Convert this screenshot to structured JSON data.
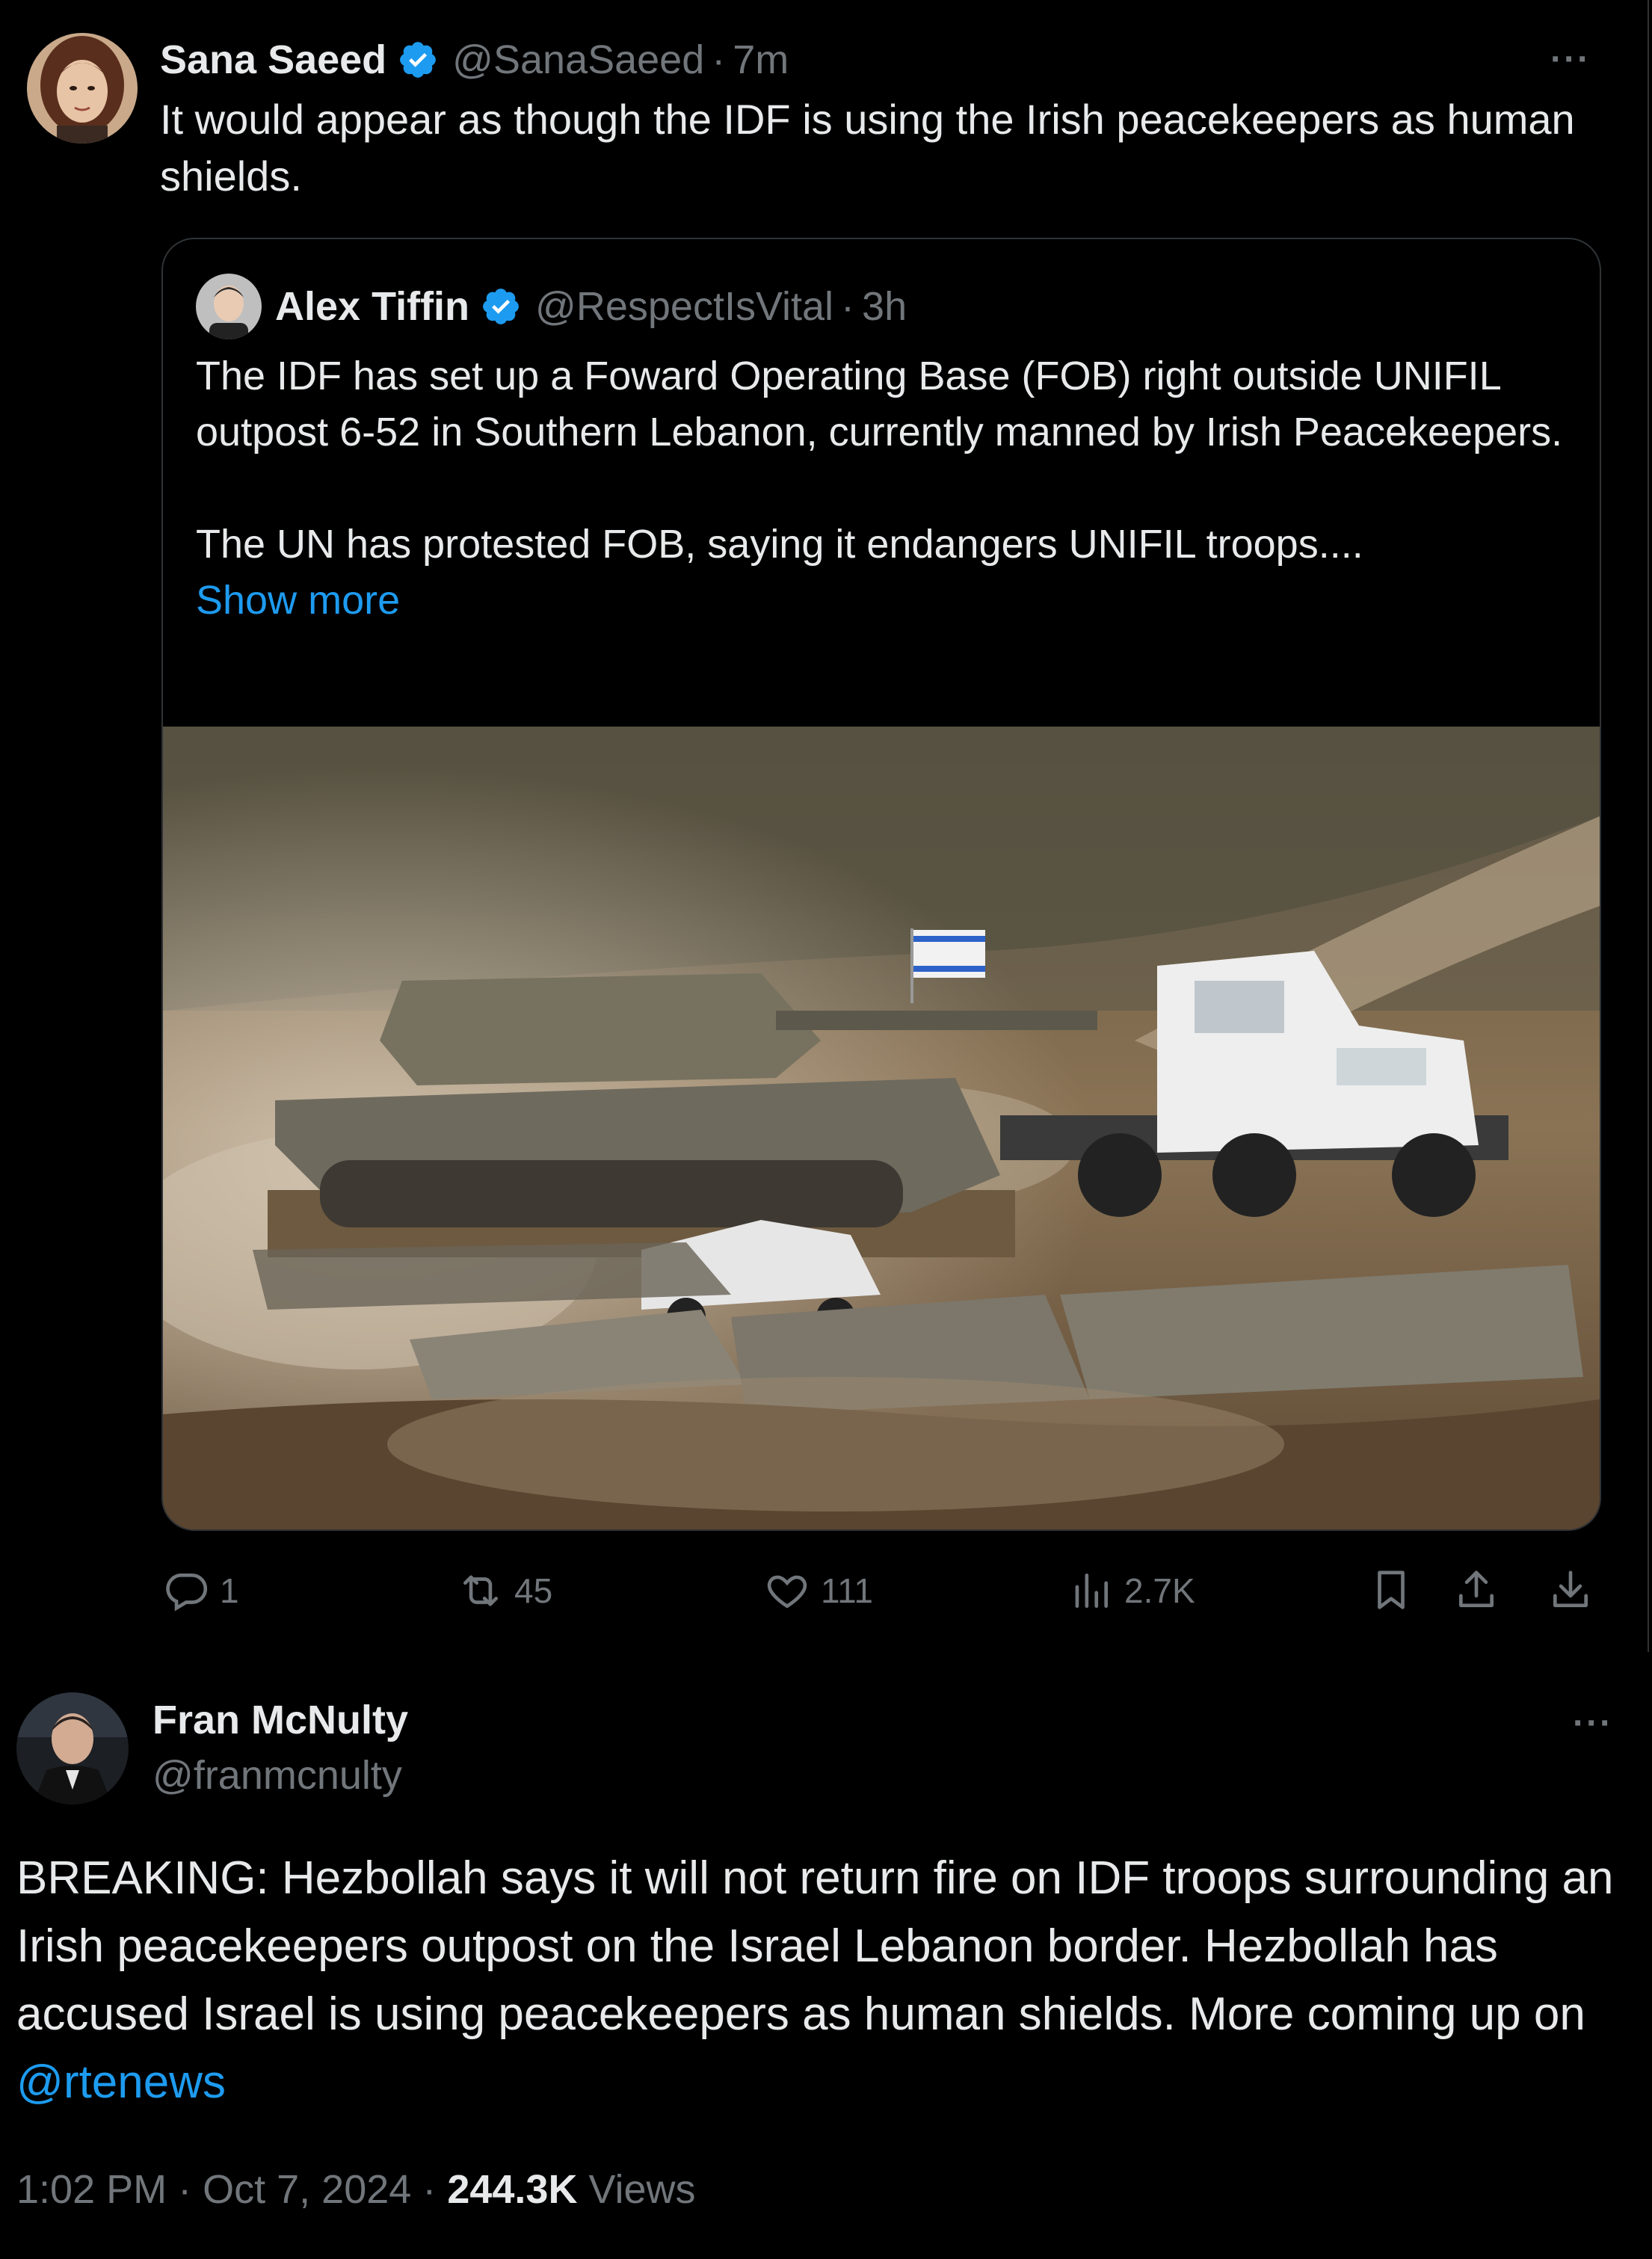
{
  "quote_tweet": {
    "author": {
      "name": "Sana Saeed",
      "handle": "@SanaSaeed",
      "separator": "·",
      "time": "7m",
      "verified": true
    },
    "text": "It would appear as though the IDF is using the Irish peacekeepers as human shields.",
    "more_label": "···",
    "quoted": {
      "author": {
        "name": "Alex Tiffin",
        "handle": "@RespectIsVital",
        "separator": "·",
        "time": "3h",
        "verified": true
      },
      "paragraph_1": "The IDF has set up a Foward Operating Base (FOB) right outside UNIFIL outpost 6-52 in Southern Lebanon, currently manned by Irish Peacekeepers.",
      "paragraph_2": "The UN has protested FOB, saying it endangers UNIFIL troops....",
      "show_more": "Show more",
      "media_icon": "military-convoy-photo"
    },
    "actions": {
      "replies": "1",
      "reposts": "45",
      "likes": "111",
      "views": "2.7K"
    }
  },
  "main_tweet": {
    "author": {
      "name": "Fran McNulty",
      "handle": "@franmcnulty"
    },
    "more_label": "···",
    "text_before_mention": "BREAKING: Hezbollah says it will not return fire on IDF troops surrounding an Irish peacekeepers outpost on the Israel Lebanon border. Hezbollah has accused Israel is using peacekeepers as human shields. More coming up on ",
    "mention": "@rtenews",
    "time": "1:02 PM",
    "date": "Oct 7, 2024",
    "separator": "·",
    "views_count": "244.3K",
    "views_label": "Views"
  },
  "colors": {
    "background": "#000000",
    "text": "#e7e9ea",
    "secondary": "#71767b",
    "accent": "#1d9bf0",
    "border": "#2f3336"
  }
}
